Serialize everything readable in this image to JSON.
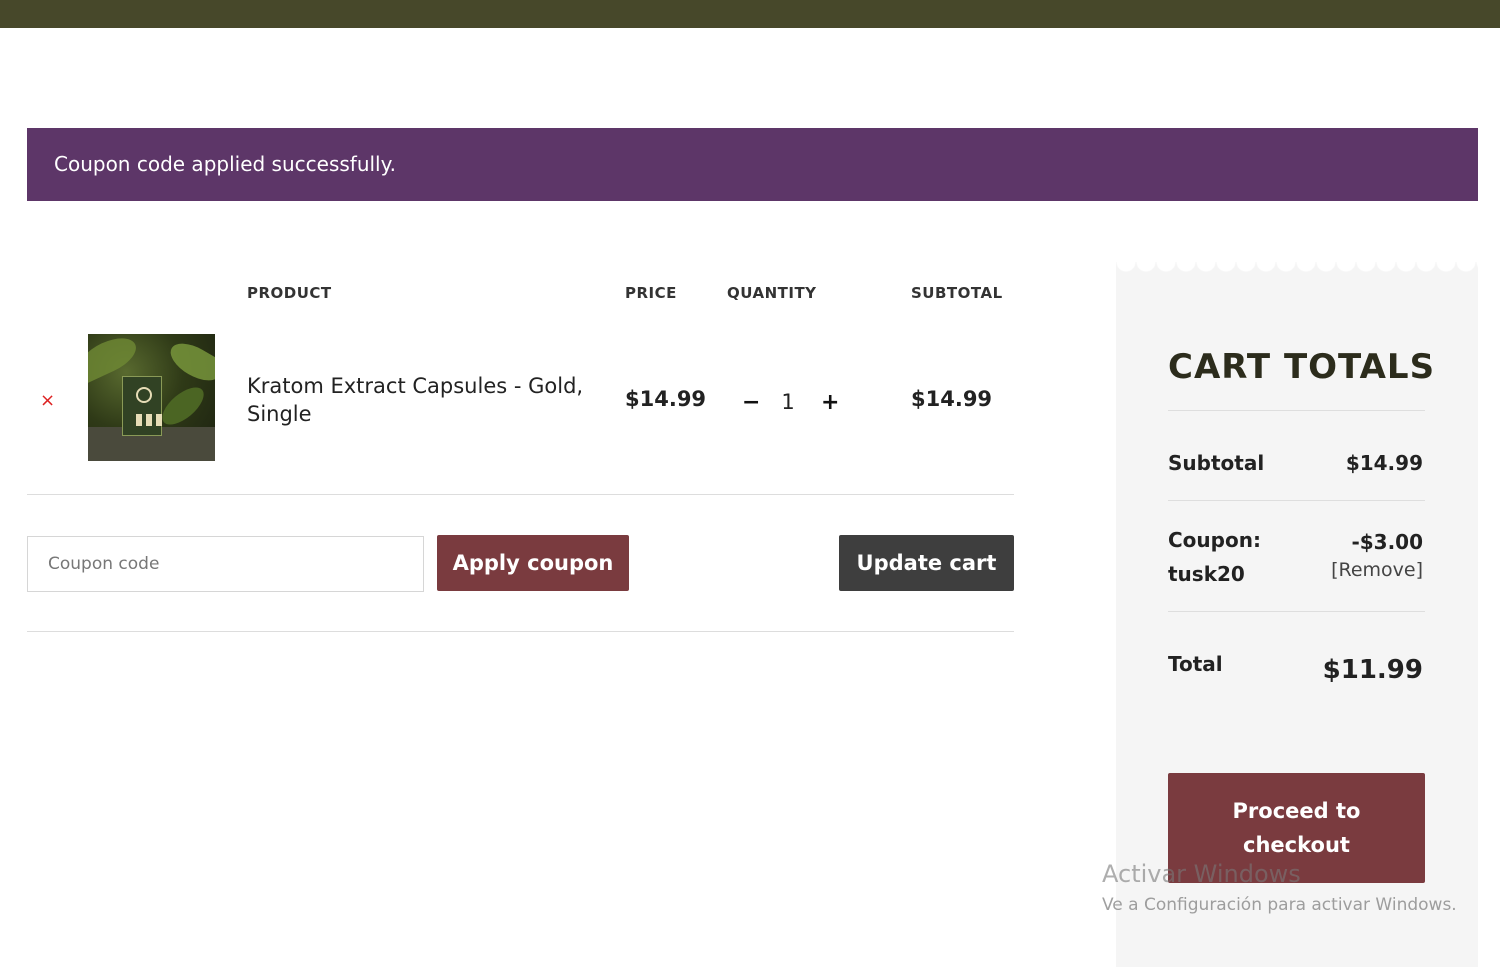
{
  "notice": {
    "text": "Coupon code applied successfully."
  },
  "cart_table": {
    "headers": {
      "product": "PRODUCT",
      "price": "PRICE",
      "quantity": "QUANTITY",
      "subtotal": "SUBTOTAL"
    },
    "items": [
      {
        "remove": "×",
        "name": "Kratom Extract Capsules - Gold, Single",
        "price": "$14.99",
        "quantity": "1",
        "qty_minus": "−",
        "qty_plus": "+",
        "subtotal": "$14.99"
      }
    ]
  },
  "coupon": {
    "placeholder": "Coupon code",
    "apply_label": "Apply coupon"
  },
  "update_label": "Update cart",
  "totals": {
    "title": "CART TOTALS",
    "subtotal_label": "Subtotal",
    "subtotal_value": "$14.99",
    "coupon_label": "Coupon:",
    "coupon_code": "tusk20",
    "coupon_value": "-$3.00",
    "remove_label": "[Remove]",
    "total_label": "Total",
    "total_value": "$11.99",
    "checkout_label": "Proceed to checkout"
  },
  "watermark": {
    "title": "Activar Windows",
    "subtitle": "Ve a Configuración para activar Windows."
  },
  "colors": {
    "top_bar": "#47482a",
    "notice_bg": "#5d3668",
    "primary_button": "#7a3b3f",
    "secondary_button": "#3e3e3e"
  }
}
